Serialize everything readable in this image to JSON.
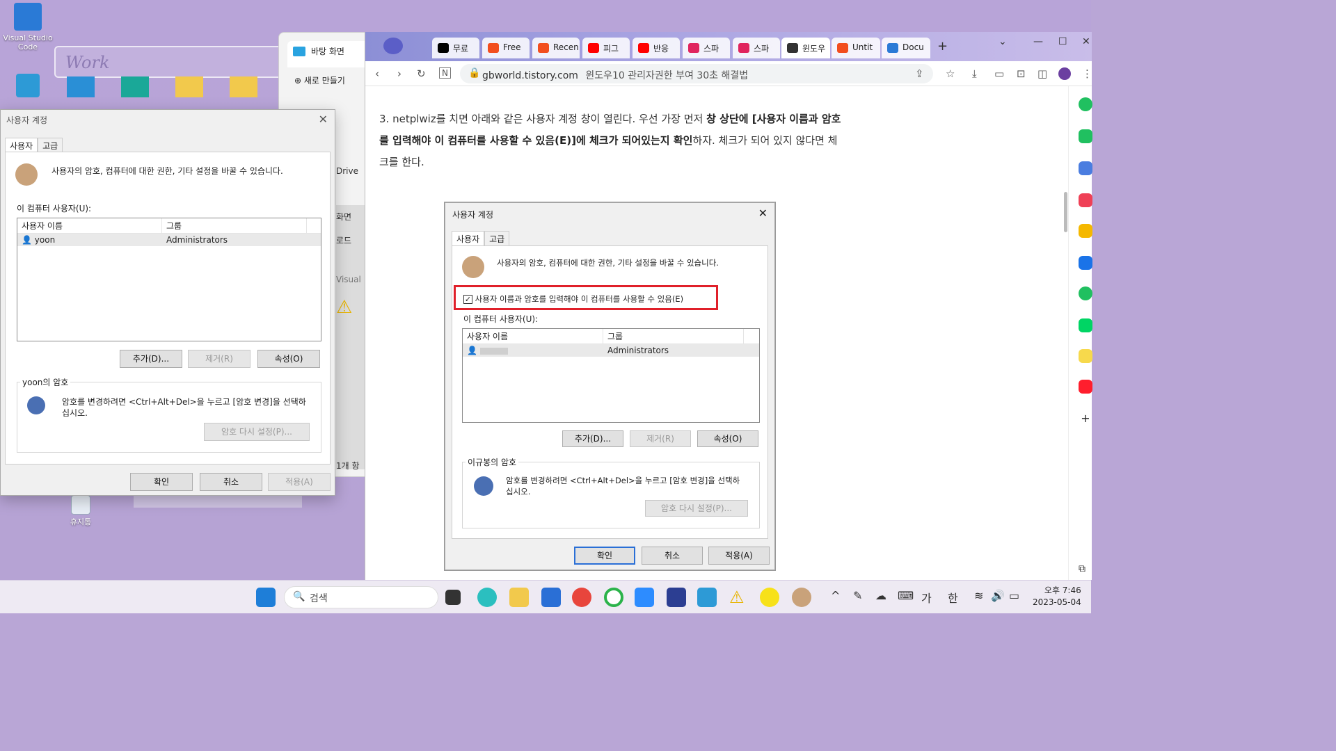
{
  "desktop": {
    "icons": [
      {
        "label": "Visual Studio Code"
      },
      {
        "label": "휴지통"
      }
    ],
    "banner": "Work"
  },
  "explorer": {
    "tab_title": "바탕 화면",
    "new_button": "새로 만들기",
    "items": [
      "Drive",
      "화면",
      "로드",
      "Visual",
      "1개 항"
    ]
  },
  "left_dialog": {
    "title": "사용자 계정",
    "tabs": [
      "사용자",
      "고급"
    ],
    "description": "사용자의 암호, 컴퓨터에 대한 권한, 기타 설정을 바꿀 수 있습니다.",
    "users_label": "이 컴퓨터 사용자(U):",
    "columns": [
      "사용자 이름",
      "그룹"
    ],
    "rows": [
      {
        "name": "yoon",
        "group": "Administrators"
      }
    ],
    "buttons": {
      "add": "추가(D)...",
      "remove": "제거(R)",
      "properties": "속성(O)"
    },
    "password_group": "yoon의 암호",
    "password_text": "암호를 변경하려면 <Ctrl+Alt+Del>을 누르고 [암호 변경]을 선택하십시오.",
    "reset_button": "암호 다시 설정(P)...",
    "ok": "확인",
    "cancel": "취소",
    "apply": "적용(A)"
  },
  "browser": {
    "tabs": [
      {
        "label": "무료",
        "color": "#000000"
      },
      {
        "label": "Free",
        "color": "#f24e1e"
      },
      {
        "label": "Recen",
        "color": "#f24e1e"
      },
      {
        "label": "피그",
        "color": "#ff0000"
      },
      {
        "label": "반응",
        "color": "#ff0000"
      },
      {
        "label": "스파",
        "color": "#e0245e"
      },
      {
        "label": "스파",
        "color": "#e0245e"
      },
      {
        "label": "윈도우",
        "color": "#333333"
      },
      {
        "label": "Untit",
        "color": "#f24e1e"
      },
      {
        "label": "Docu",
        "color": "#2a7ad6"
      }
    ],
    "address_host": "gbworld.tistory.com",
    "address_title": "윈도우10 관리자권한 부여 30초 해결법",
    "paragraph_plain_1": "3. netplwiz를 치면 아래와 같은 사용자 계정 창이 열린다. 우선 가장 먼저 ",
    "paragraph_bold": "창 상단에 [사용자 이름과 암호를 입력해야 이 컴퓨터를 사용할 수 있음(E)]에 체크가 되어있는지 확인",
    "paragraph_plain_2": "하자. 체크가 되어 있지 않다면 체크를 한다."
  },
  "embedded_dialog": {
    "title": "사용자 계정",
    "tabs": [
      "사용자",
      "고급"
    ],
    "description": "사용자의 암호, 컴퓨터에 대한 권한, 기타 설정을 바꿀 수 있습니다.",
    "checkbox_label": "사용자 이름과 암호를 입력해야 이 컴퓨터를 사용할 수 있음(E)",
    "checkbox_checked": true,
    "users_label": "이 컴퓨터 사용자(U):",
    "columns": [
      "사용자 이름",
      "그룹"
    ],
    "rows": [
      {
        "name": "",
        "group": "Administrators"
      }
    ],
    "buttons": {
      "add": "추가(D)...",
      "remove": "제거(R)",
      "properties": "속성(O)"
    },
    "password_group": "이규봉의 암호",
    "password_text": "암호를 변경하려면 <Ctrl+Alt+Del>을 누르고 [암호 변경]을 선택하십시오.",
    "reset_button": "암호 다시 설정(P)...",
    "ok": "확인",
    "cancel": "취소",
    "apply": "적용(A)"
  },
  "taskbar": {
    "search_placeholder": "검색",
    "ime_a": "가",
    "ime_b": "한",
    "time": "오후 7:46",
    "date": "2023-05-04"
  }
}
